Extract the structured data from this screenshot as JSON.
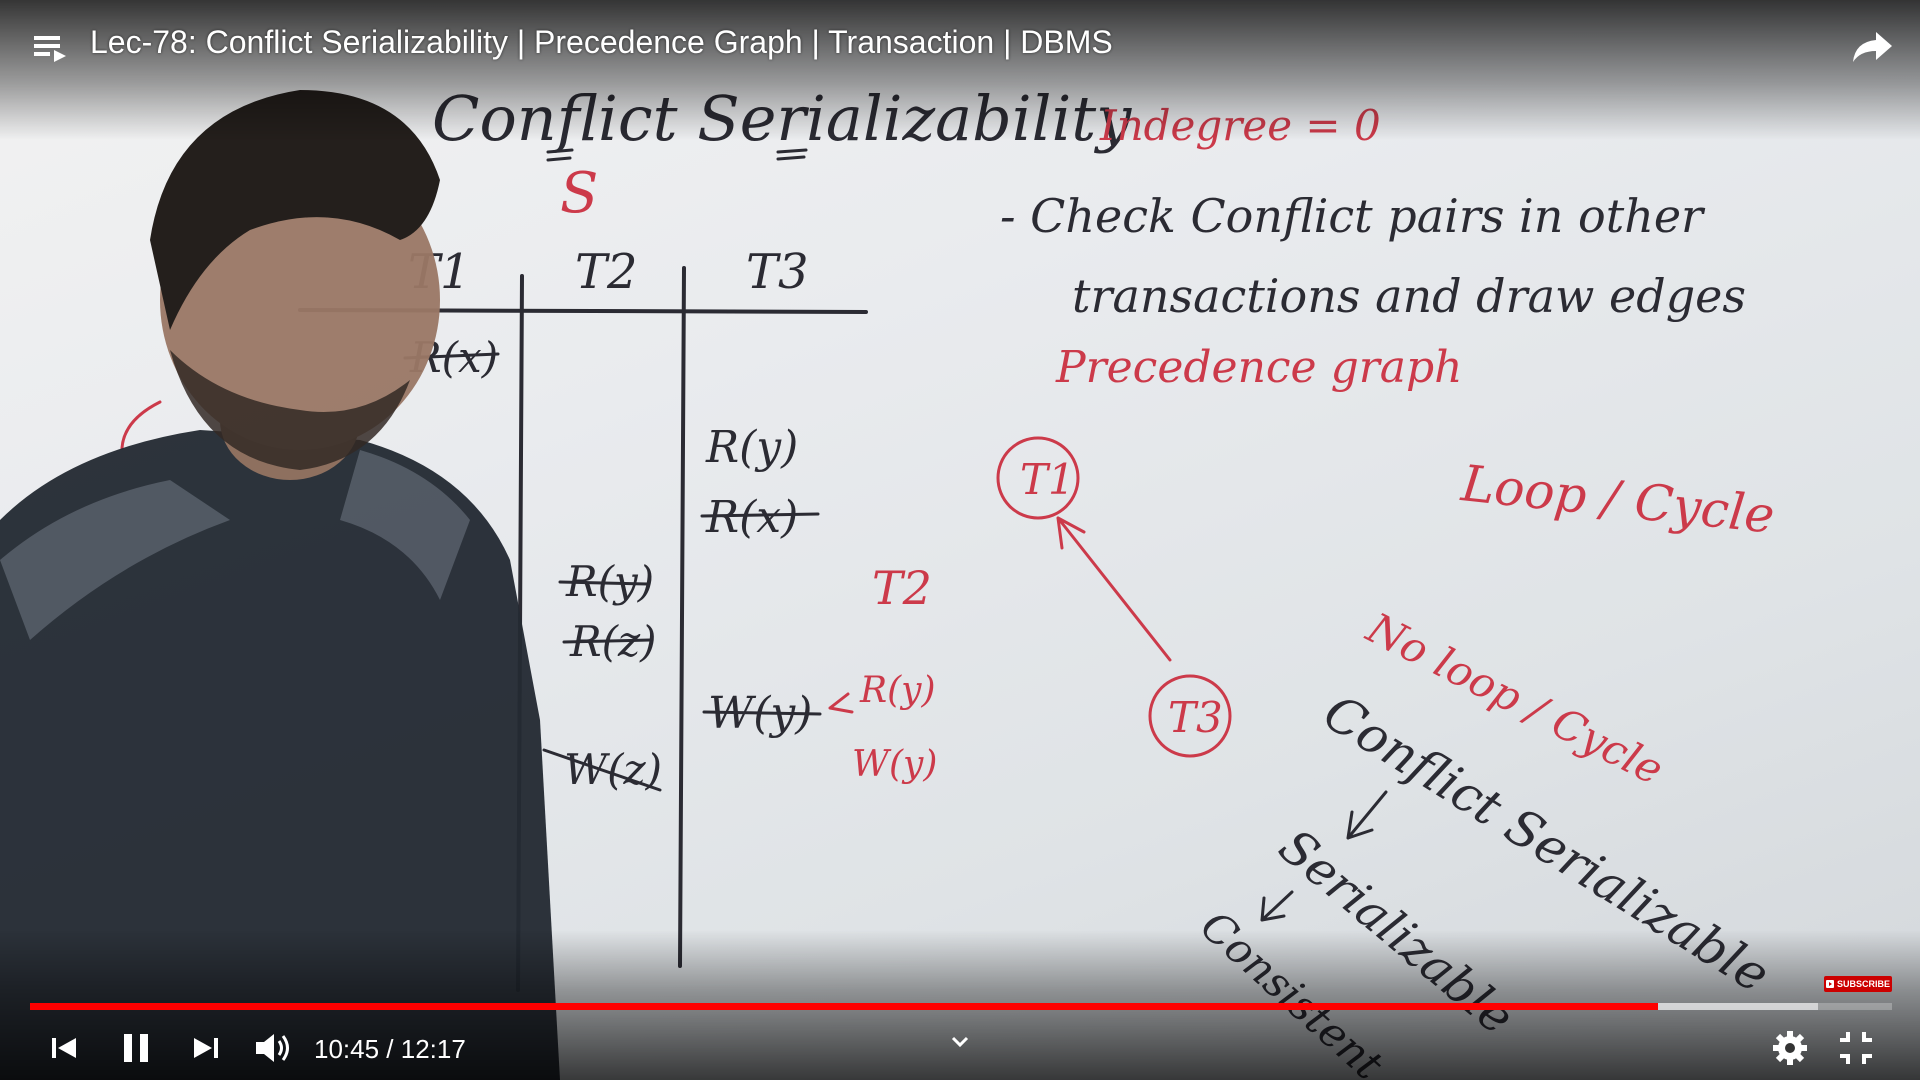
{
  "video": {
    "title": "Lec-78: Conflict Serializability | Precedence Graph | Transaction | DBMS",
    "current_time": "10:45",
    "duration": "12:17",
    "time_display": "10:45 / 12:17",
    "progress_fraction": 0.8743,
    "buffered_fraction": 0.96
  },
  "whiteboard": {
    "heading": "Conflict Serializability",
    "heading_sub": "S",
    "side_note": "Indegree = 0",
    "step_line1": "- Check Conflict pairs in other",
    "step_line2": "transactions and draw edges",
    "precedence_label": "Precedence graph",
    "columns": [
      "T1",
      "T2",
      "T3"
    ],
    "t1_ops": [
      "R(x)"
    ],
    "t2_ops": [
      "R(y)",
      "R(z)",
      "W(z)"
    ],
    "t3_ops": [
      "R(y)",
      "R(x)",
      "W(y)"
    ],
    "margin_note_t2": "T2",
    "margin_note_ops": [
      "R(y)",
      "W(y)"
    ],
    "graph_nodes": [
      "T1",
      "T3"
    ],
    "loop_label": "Loop / Cycle",
    "no_loop_label": "No loop / Cycle",
    "conclusion_1": "Conflict Serializable",
    "conclusion_2": "Serializable",
    "conclusion_3": "Consistent"
  },
  "watermark": {
    "subscribe_label": "SUBSCRIBE"
  },
  "icons": {
    "playlist": "playlist-icon",
    "share": "share-icon",
    "prev": "skip-previous-icon",
    "pause": "pause-icon",
    "next": "skip-next-icon",
    "volume": "volume-icon",
    "chevron": "chevron-down-icon",
    "settings": "gear-icon",
    "exit_fullscreen": "exit-fullscreen-icon"
  },
  "colors": {
    "progress_played": "#ff0000",
    "ink_red": "#cc3a4a",
    "ink_dark": "#2b2b33"
  }
}
